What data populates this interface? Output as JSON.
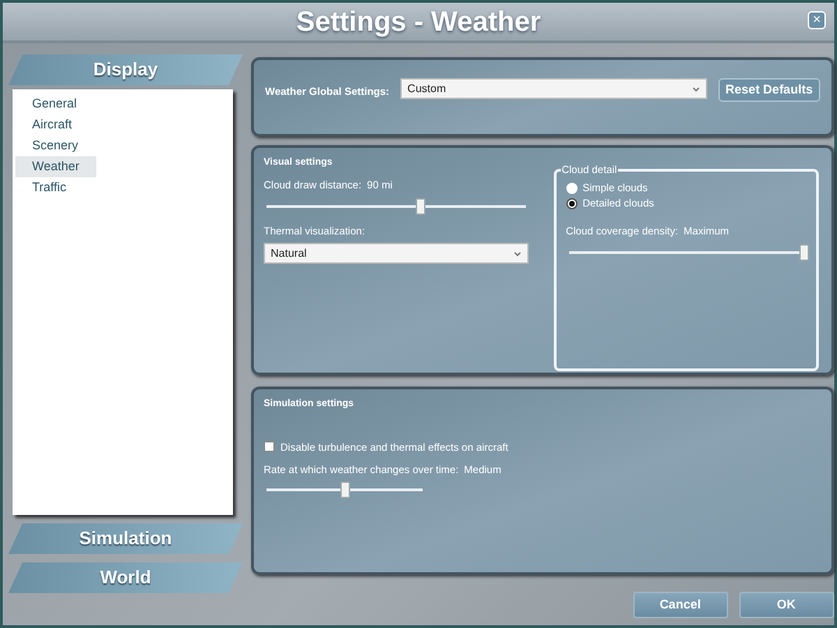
{
  "window": {
    "title": "Settings - Weather",
    "close": "×"
  },
  "sidebar": {
    "sections": [
      {
        "label": "Display",
        "items": [
          {
            "label": "General",
            "selected": false
          },
          {
            "label": "Aircraft",
            "selected": false
          },
          {
            "label": "Scenery",
            "selected": false
          },
          {
            "label": "Weather",
            "selected": true
          },
          {
            "label": "Traffic",
            "selected": false
          }
        ]
      },
      {
        "label": "Simulation"
      },
      {
        "label": "World"
      }
    ]
  },
  "global": {
    "label": "Weather Global Settings:",
    "value": "Custom",
    "button": "Reset Defaults"
  },
  "visual": {
    "title": "Visual settings",
    "draw_distance": {
      "label": "Cloud draw distance:",
      "reading": "90 mi",
      "level": 0.6
    },
    "thermal": {
      "label": "Thermal visualization:",
      "value": "Natural"
    },
    "cloud_detail": {
      "title": "Cloud detail",
      "options": [
        {
          "label": "Simple clouds",
          "selected": false
        },
        {
          "label": "Detailed clouds",
          "selected": true
        }
      ],
      "density": {
        "label": "Cloud coverage density:",
        "reading": "Maximum",
        "level": 1.0
      }
    }
  },
  "simulation": {
    "title": "Simulation settings",
    "checkbox": {
      "label": "Disable turbulence and thermal effects on aircraft",
      "checked": false
    },
    "rate": {
      "label": "Rate at which weather changes over time:",
      "reading": "Medium",
      "level": 0.5
    }
  },
  "buttons": [
    "Cancel",
    "OK"
  ]
}
